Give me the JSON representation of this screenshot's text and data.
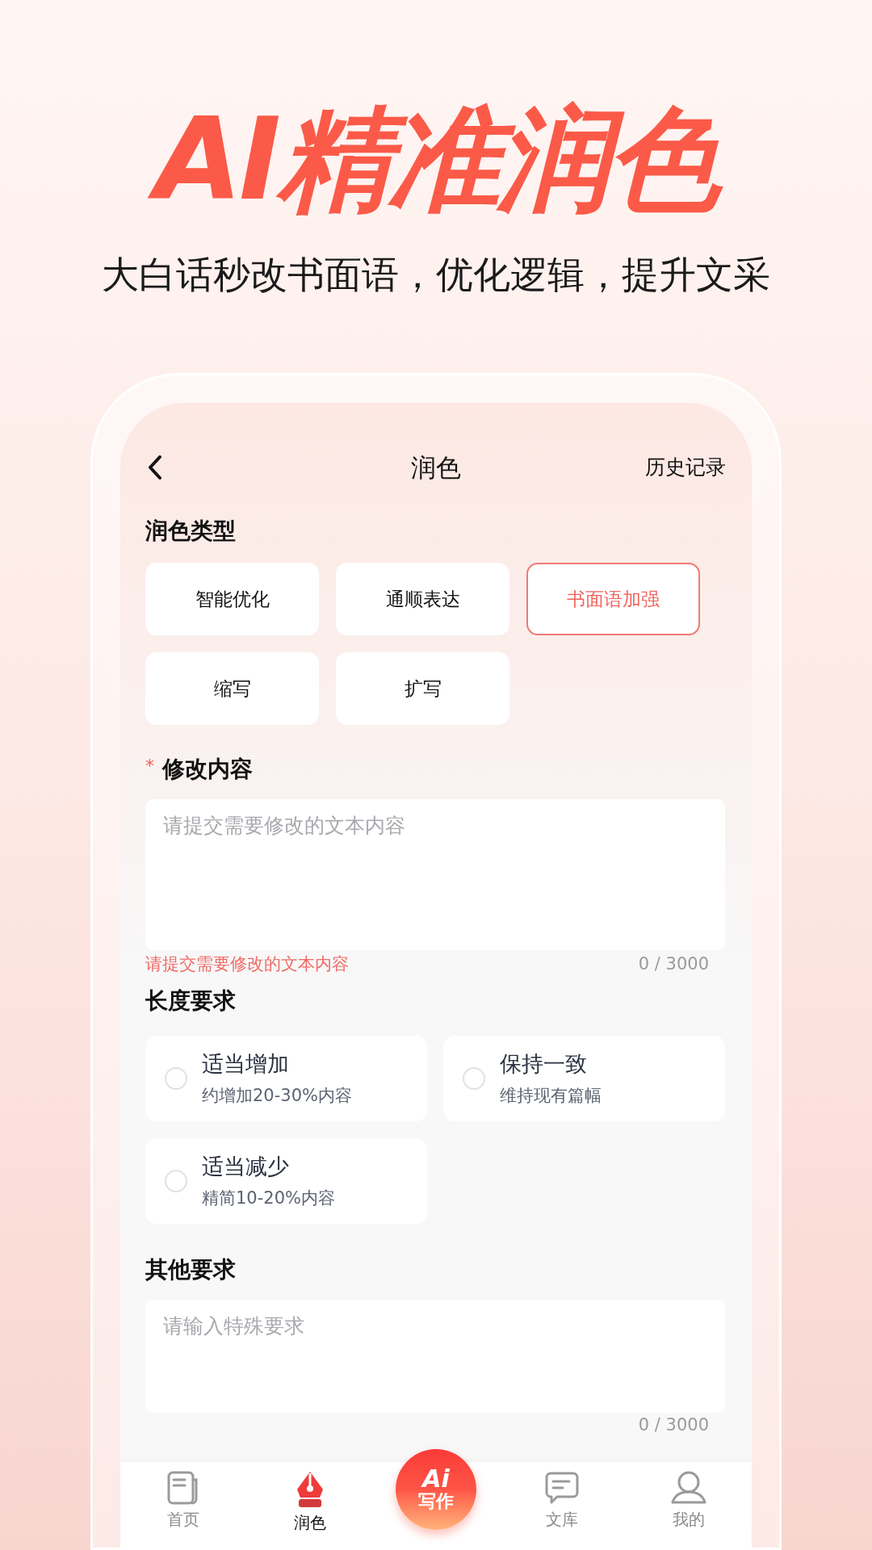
{
  "promo": {
    "headline": "AI精准润色",
    "subtitle": "大白话秒改书面语，优化逻辑，提升文采"
  },
  "header": {
    "title": "润色",
    "action": "历史记录"
  },
  "polish_type": {
    "label": "润色类型",
    "options": [
      {
        "label": "智能优化",
        "selected": false
      },
      {
        "label": "通顺表达",
        "selected": false
      },
      {
        "label": "书面语加强",
        "selected": true
      },
      {
        "label": "缩写",
        "selected": false
      },
      {
        "label": "扩写",
        "selected": false
      }
    ]
  },
  "content": {
    "required_mark": "*",
    "label": "修改内容",
    "placeholder": "请提交需要修改的文本内容",
    "error": "请提交需要修改的文本内容",
    "counter": "0 / 3000"
  },
  "length": {
    "label": "长度要求",
    "options": [
      {
        "title": "适当增加",
        "desc": "约增加20-30%内容",
        "selected": false
      },
      {
        "title": "保持一致",
        "desc": "维持现有篇幅",
        "selected": false
      },
      {
        "title": "适当减少",
        "desc": "精简10-20%内容",
        "selected": false
      }
    ]
  },
  "other": {
    "label": "其他要求",
    "placeholder": "请输入特殊要求",
    "counter": "0 / 3000"
  },
  "nav": [
    {
      "kind": "tab",
      "label": "首页",
      "selected": false
    },
    {
      "kind": "tab",
      "label": "润色",
      "selected": true
    },
    {
      "kind": "center",
      "logo": "Ai",
      "label": "写作"
    },
    {
      "kind": "tab",
      "label": "文库",
      "selected": false
    },
    {
      "kind": "tab",
      "label": "我的",
      "selected": false
    }
  ]
}
